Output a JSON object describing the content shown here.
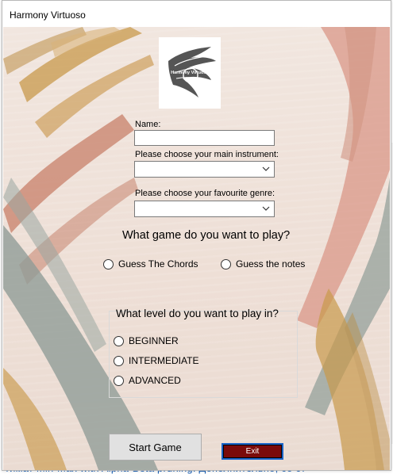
{
  "window": {
    "title": "Harmony Virtuoso"
  },
  "logo": {
    "icon": "harmony-virtuoso-word-cloud-bird-logo",
    "text": "Harmony Virtuoso"
  },
  "form": {
    "name_label": "Name:",
    "name_value": "",
    "instrument_label": "Please choose your main instrument:",
    "instrument_value": "",
    "genre_label": "Please choose your favourite genre:",
    "genre_value": ""
  },
  "game": {
    "question": "What game do you want to play?",
    "options": [
      "Guess The Chords",
      "Guess the notes"
    ]
  },
  "level": {
    "question": "What level do you want to play in?",
    "options": [
      "BEGINNER",
      "INTERMEDIATE",
      "ADVANCED"
    ]
  },
  "buttons": {
    "start": "Start Game",
    "exit": "Exit"
  },
  "background": {
    "bottom_text": "тимат Min-Max with Alpha-Beta pruning. Дополнительно, со ст"
  },
  "colors": {
    "exit_bg": "#7a0a0a",
    "exit_border": "#1a64c8",
    "paper": "#efe2da"
  }
}
